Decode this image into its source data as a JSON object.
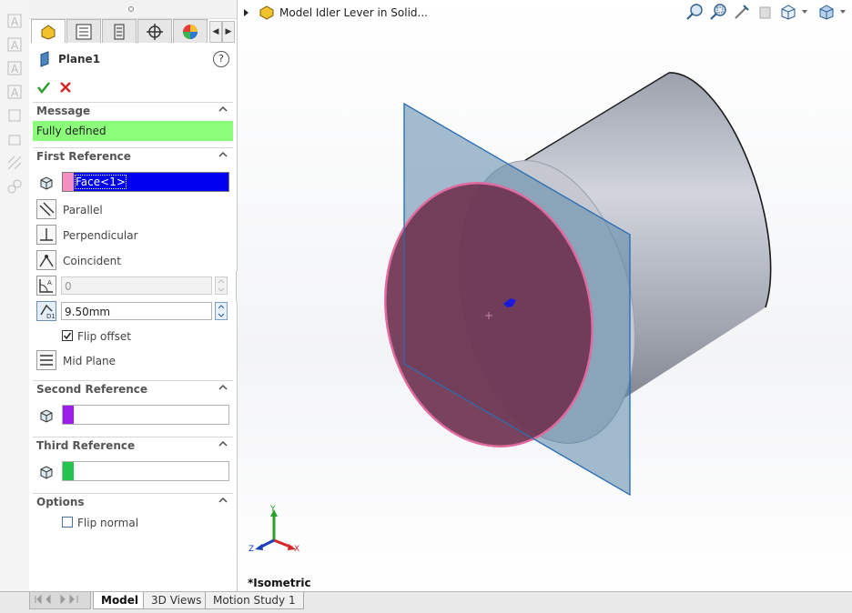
{
  "viewport": {
    "breadcrumb": "Model Idler Lever in Solid...",
    "view_label": "*Isometric",
    "triad": {
      "x": "X",
      "y": "Y",
      "z": "Z"
    }
  },
  "pm": {
    "title": "Plane1",
    "help": "?",
    "message": {
      "title": "Message",
      "text": "Fully defined"
    },
    "first_reference": {
      "title": "First Reference",
      "selection": "Face<1>",
      "color": "#f58fc0",
      "options": [
        "Parallel",
        "Perpendicular",
        "Coincident"
      ],
      "angle_value": "0",
      "distance_value": "9.50mm",
      "flip_offset": "Flip offset",
      "flip_offset_checked": true,
      "mid_plane": "Mid Plane"
    },
    "second_reference": {
      "title": "Second Reference",
      "color": "#9b1dea"
    },
    "third_reference": {
      "title": "Third Reference",
      "color": "#22c44e"
    },
    "options": {
      "title": "Options",
      "flip_normal": "Flip normal",
      "flip_normal_checked": false
    }
  },
  "bottom_tabs": [
    "Model",
    "3D Views",
    "Motion Study 1"
  ],
  "colors": {
    "message_bg": "#8cff7a",
    "selection_bg": "#0000f0",
    "ok_green": "#2ca02c",
    "cancel_red": "#d62828",
    "plane_fill": "#5a86a8",
    "face_fill": "#6e3350",
    "face_edge": "#e06aa0"
  }
}
